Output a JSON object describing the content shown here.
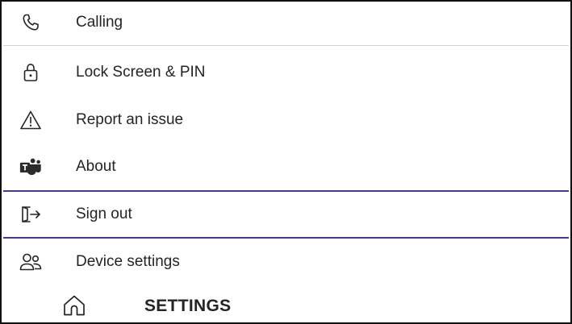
{
  "settings_menu": {
    "items": [
      {
        "label": "Calling",
        "icon": "phone-icon"
      },
      {
        "label": "Lock Screen & PIN",
        "icon": "lock-icon"
      },
      {
        "label": "Report an issue",
        "icon": "warning-icon"
      },
      {
        "label": "About",
        "icon": "teams-logo-icon"
      },
      {
        "label": "Sign out",
        "icon": "sign-out-icon",
        "selected": true
      },
      {
        "label": "Device settings",
        "icon": "people-icon"
      }
    ]
  },
  "bottom_bar": {
    "home_icon": "home-icon",
    "title": "SETTINGS"
  },
  "colors": {
    "selection_border": "#3d3a8f",
    "text": "#242424",
    "divider": "#d4d4d4",
    "teams_logo": "#2b2b2b"
  }
}
